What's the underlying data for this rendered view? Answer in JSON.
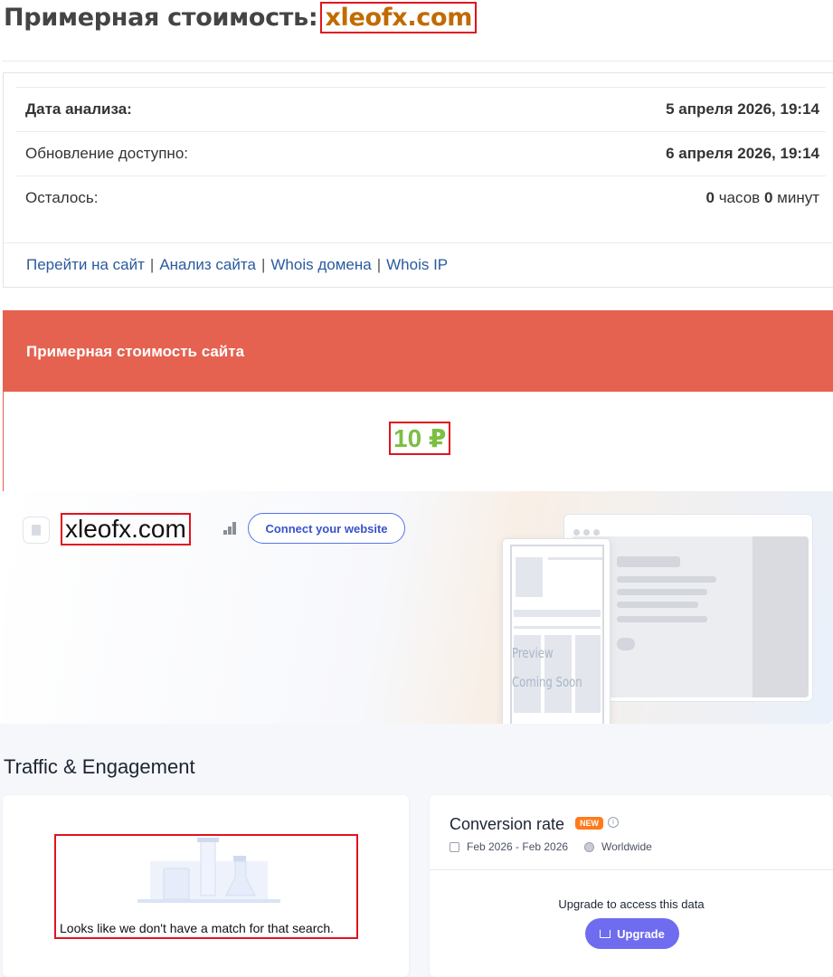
{
  "header": {
    "title_prefix": "Примерная стоимость:",
    "domain": "xleofx.com"
  },
  "info": {
    "rows": [
      {
        "label": "Дата анализа:",
        "value": "5 апреля 2026, 19:14"
      },
      {
        "label": "Обновление доступно:",
        "value": "6 апреля 2026, 19:14"
      }
    ],
    "remaining": {
      "label": "Осталось:",
      "hours": "0",
      "hours_unit": "часов",
      "minutes": "0",
      "minutes_unit": "минут"
    },
    "links": [
      "Перейти на сайт",
      "Анализ сайта",
      "Whois домена",
      "Whois IP"
    ]
  },
  "price": {
    "heading": "Примерная стоимость сайта",
    "value": "10 ₽"
  },
  "hero": {
    "site_name": "xleofx.com",
    "connect_label": "Connect your website",
    "preview_line1": "Preview",
    "preview_line2": "Coming Soon"
  },
  "traffic": {
    "title": "Traffic & Engagement",
    "no_match": "Looks like we don't have a match for that search.",
    "conversion": {
      "title": "Conversion rate",
      "badge": "NEW",
      "info": "i",
      "period": "Feb 2026 - Feb 2026",
      "region": "Worldwide",
      "upgrade_text": "Upgrade to access this data",
      "upgrade_label": "Upgrade"
    }
  },
  "colors": {
    "accent_red": "#e56251",
    "price_green": "#7cbf43",
    "domain_orange": "#c26a00",
    "link_blue": "#2b5a9e",
    "upgrade_purple": "#6f6cf0",
    "badge_orange": "#ff7a1a"
  }
}
